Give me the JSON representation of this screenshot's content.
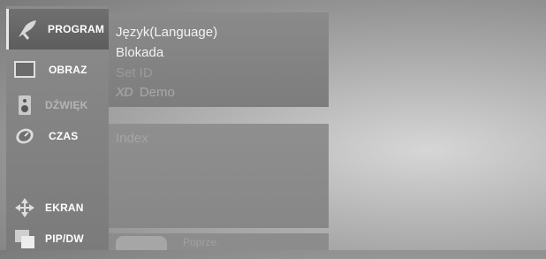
{
  "sidebar": {
    "items": [
      {
        "label": "PROGRAM",
        "icon": "satellite-dish-icon"
      },
      {
        "label": "OBRAZ",
        "icon": "monitor-icon"
      },
      {
        "label": "DŹWIĘK",
        "icon": "speaker-icon"
      },
      {
        "label": "CZAS",
        "icon": "clock-icon"
      },
      {
        "label": "EKRAN",
        "icon": "move-arrows-icon"
      },
      {
        "label": "PIP/DW",
        "icon": "pip-windows-icon"
      }
    ],
    "selected_index": 0
  },
  "submenu": {
    "items": [
      {
        "label": "Język(Language)"
      },
      {
        "label": "Blokada"
      },
      {
        "label": "Set ID"
      },
      {
        "logo": "XD",
        "label": "Demo"
      }
    ]
  },
  "lower_panel": {
    "label": "Index"
  },
  "footer": {
    "hint_text": "Poprze."
  },
  "colors": {
    "menu_text": "#ffffff",
    "dim_text": "#a9a9a9",
    "panel_bg": "#8a8a8a"
  }
}
